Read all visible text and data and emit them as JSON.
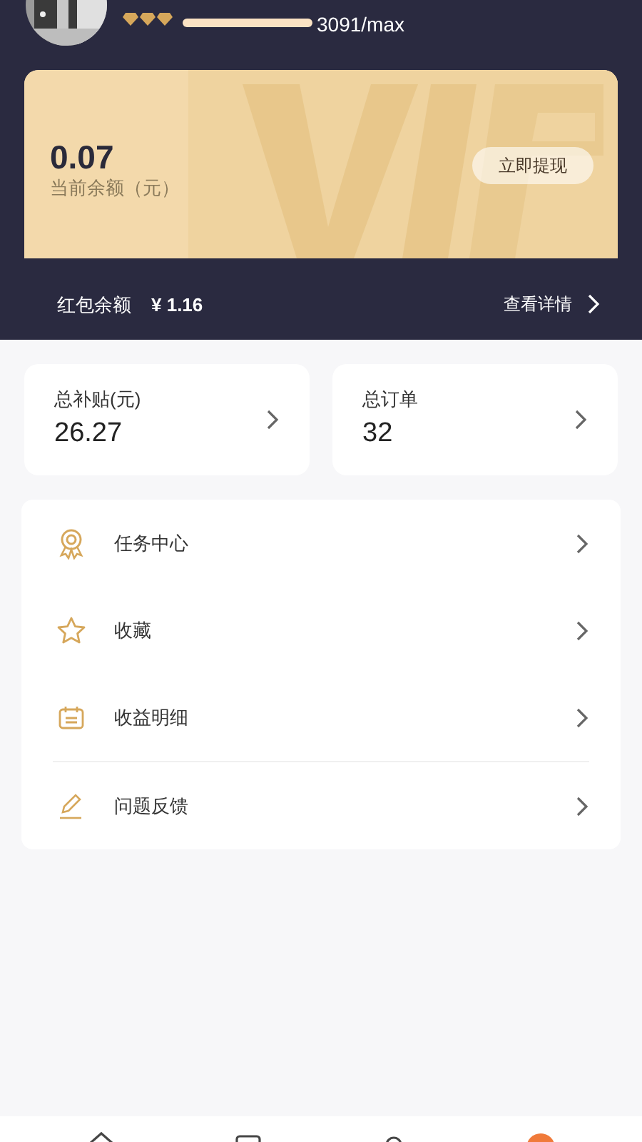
{
  "profile": {
    "progress": {
      "reading": "3091/max"
    }
  },
  "vip_card": {
    "balance": "0.07",
    "balance_label": "当前余额（元）",
    "withdraw_button": "立即提现"
  },
  "red_packet": {
    "label": "红包余额",
    "amount": "¥ 1.16",
    "details_link": "查看详情"
  },
  "stats": [
    {
      "label": "总补贴(元)",
      "value": "26.27"
    },
    {
      "label": "总订单",
      "value": "32"
    }
  ],
  "menu": [
    {
      "kind": "badge",
      "label": "任务中心"
    },
    {
      "kind": "star",
      "label": "收藏"
    },
    {
      "kind": "calendar",
      "label": "收益明细"
    },
    {
      "kind": "pencil",
      "label": "问题反馈"
    }
  ],
  "tab_bar": [
    {
      "kind": "home",
      "selected": false
    },
    {
      "kind": "box",
      "selected": false
    },
    {
      "kind": "person",
      "selected": false
    },
    {
      "kind": "dot",
      "selected": true
    }
  ]
}
